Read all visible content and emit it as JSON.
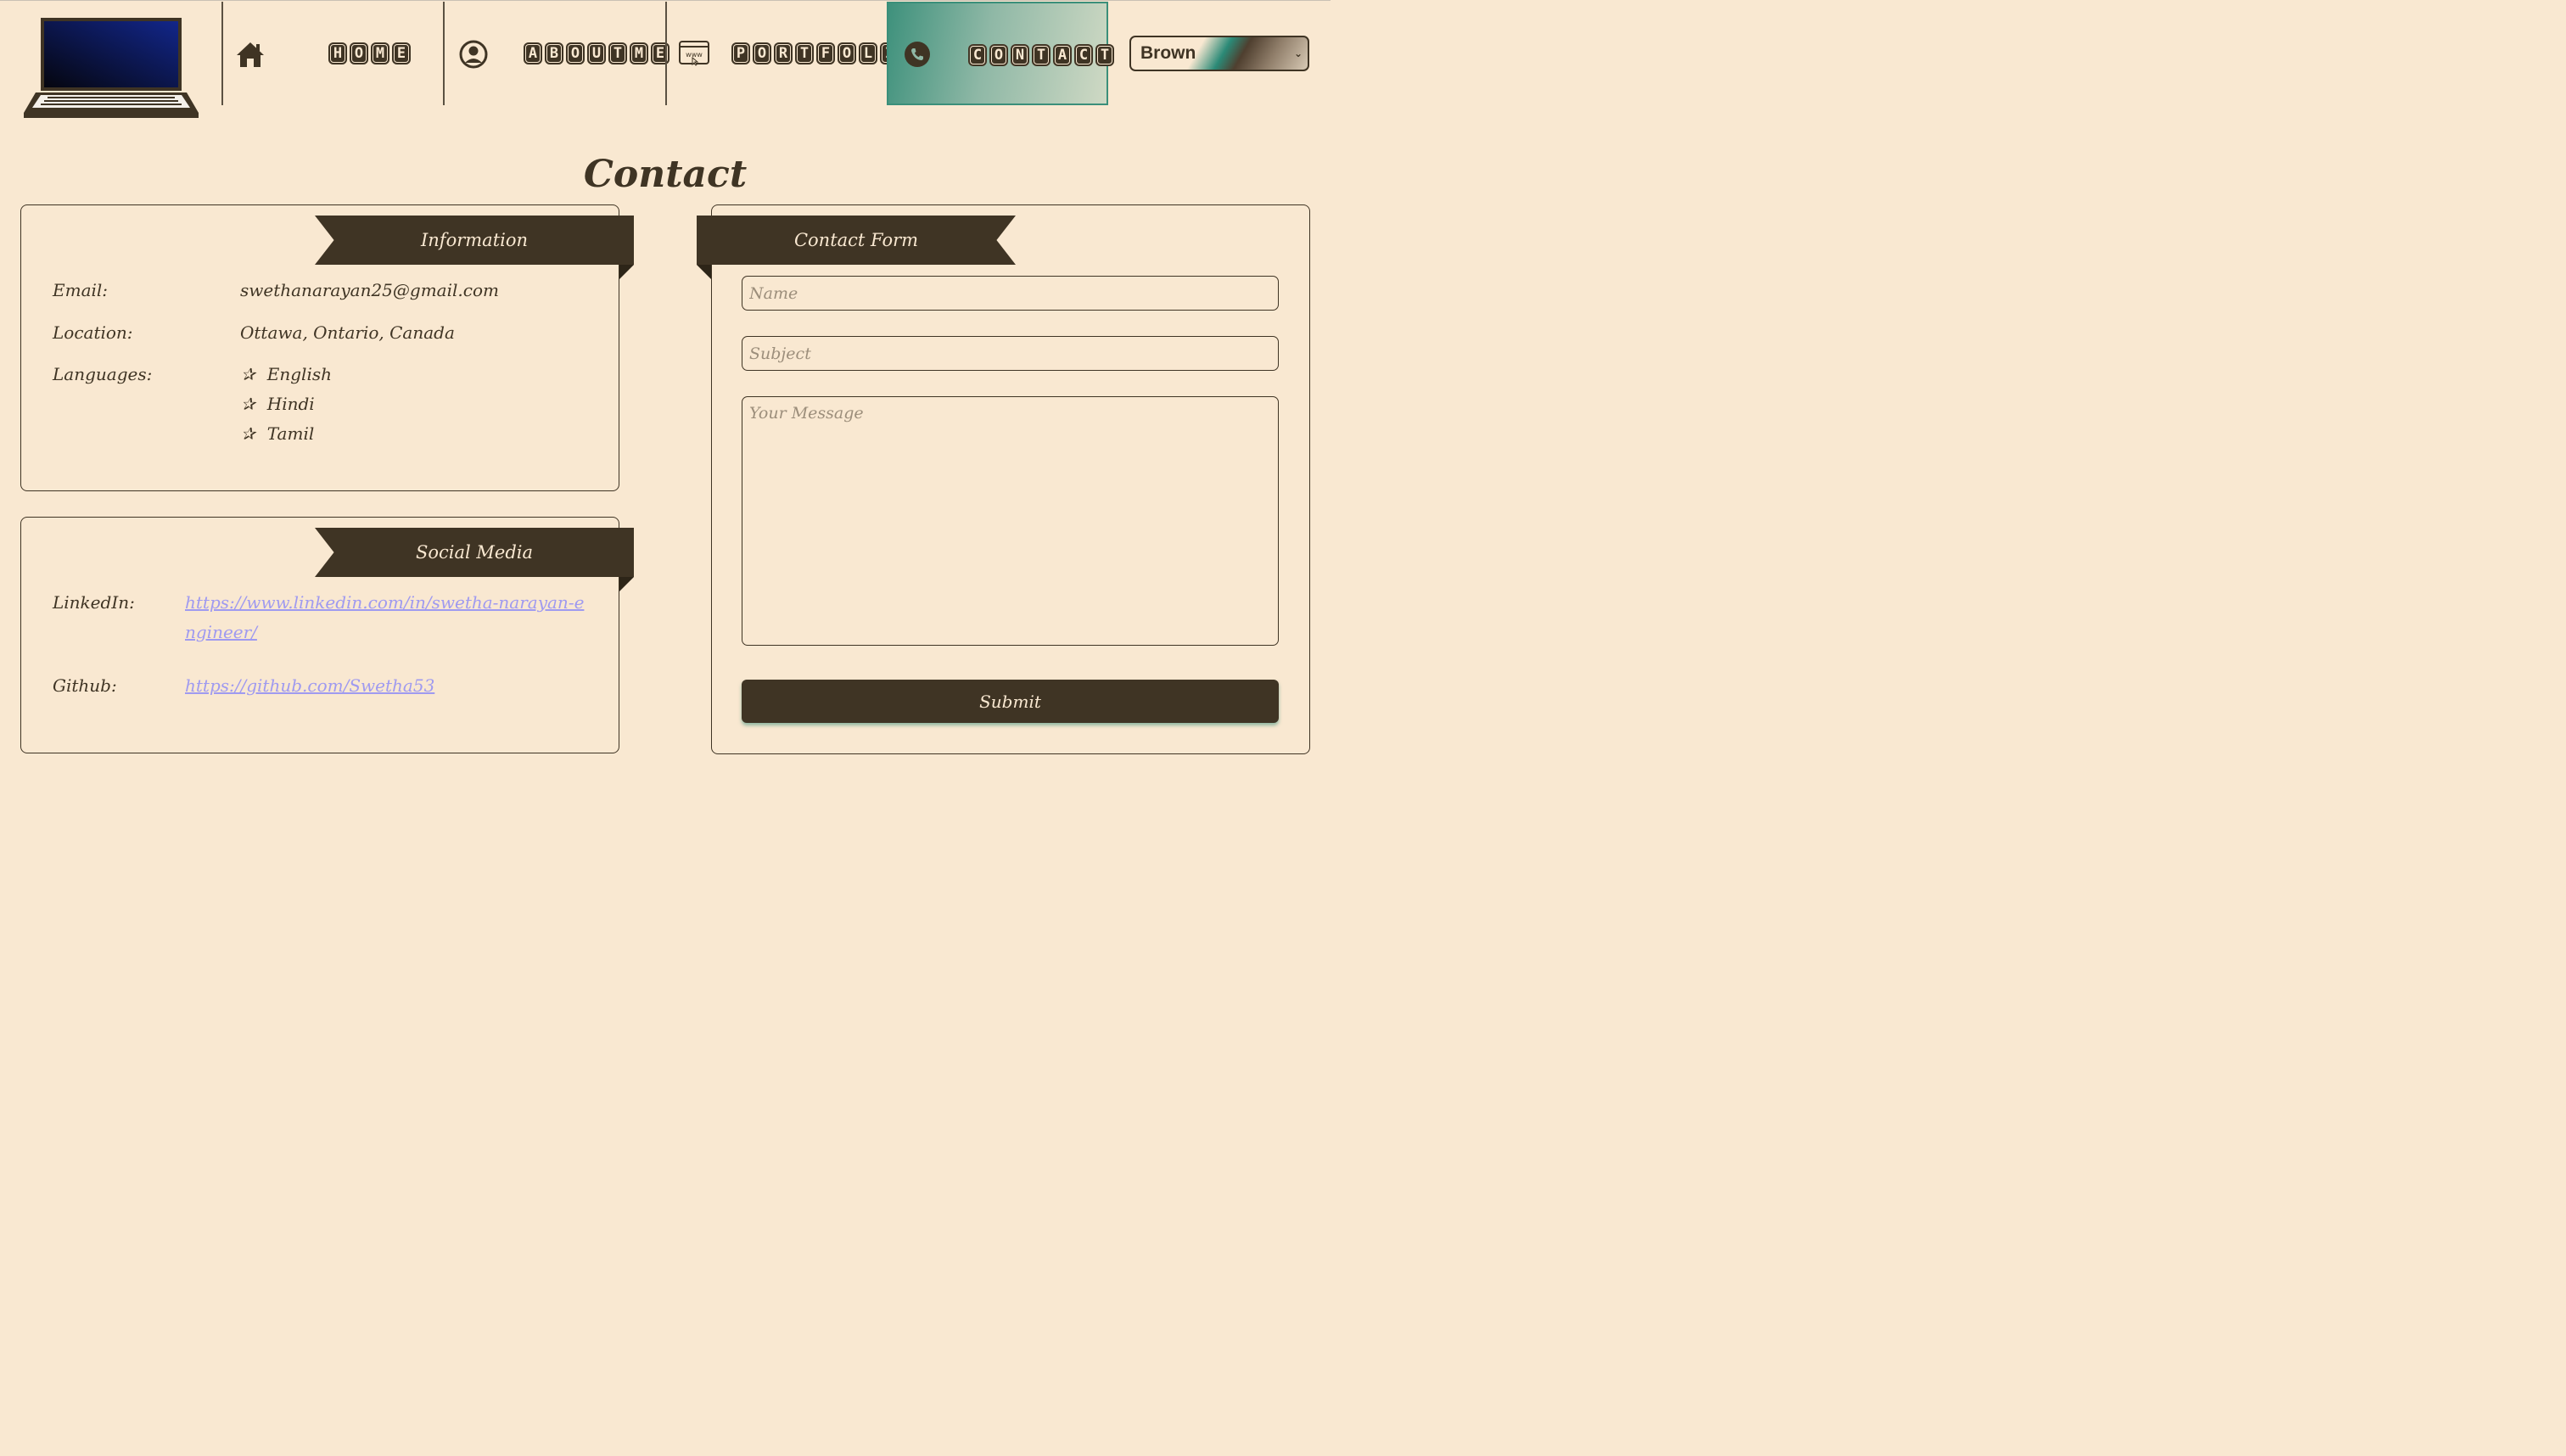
{
  "nav": {
    "items": [
      {
        "label": "HOME",
        "icon": "home-icon"
      },
      {
        "label": "ABOUTME",
        "icon": "user-circle-icon"
      },
      {
        "label": "PORTFOLIO",
        "icon": "www-browser-icon"
      },
      {
        "label": "CONTACT",
        "icon": "phone-icon",
        "active": true
      }
    ],
    "theme_select": {
      "value": "Brown"
    }
  },
  "page_title": "Contact",
  "information": {
    "heading": "Information",
    "email_label": "Email:",
    "email_value": "swethanarayan25@gmail.com",
    "location_label": "Location:",
    "location_value": "Ottawa, Ontario, Canada",
    "languages_label": "Languages:",
    "languages": [
      "English",
      "Hindi",
      "Tamil"
    ],
    "star": "✰"
  },
  "social": {
    "heading": "Social Media",
    "linkedin_label": "LinkedIn:",
    "linkedin_url": "https://www.linkedin.com/in/swetha-narayan-engineer/",
    "github_label": "Github:",
    "github_url": "https://github.com/Swetha53"
  },
  "contact_form": {
    "heading": "Contact Form",
    "name_placeholder": "Name",
    "subject_placeholder": "Subject",
    "message_placeholder": "Your Message",
    "submit_label": "Submit"
  },
  "colors": {
    "background": "#f9e8d1",
    "dark_brown": "#3f3424",
    "accent_teal": "#3b8f7a",
    "link": "#9f9af0"
  }
}
